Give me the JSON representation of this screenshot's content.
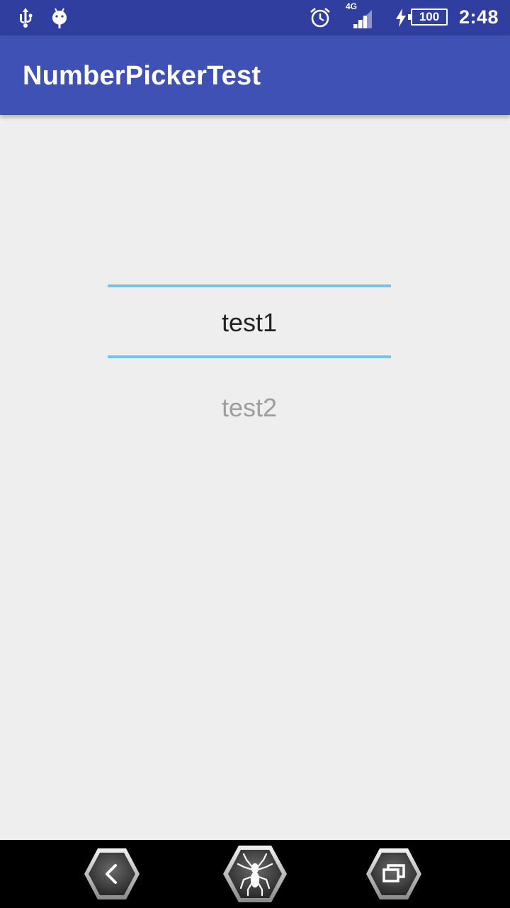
{
  "status_bar": {
    "icons_left": [
      "usb-icon",
      "android-debug-icon"
    ],
    "network_label": "4G",
    "battery_level": "100",
    "time": "2:48",
    "icons_right": [
      "alarm-icon",
      "signal-icon",
      "charging-icon",
      "battery-icon"
    ]
  },
  "app_bar": {
    "title": "NumberPickerTest"
  },
  "picker": {
    "selected_value": "test1",
    "next_value": "test2",
    "accent_color": "#6fc6e6"
  },
  "nav_bar": {
    "buttons": [
      "back-icon",
      "home-spider-icon",
      "recents-icon"
    ]
  },
  "colors": {
    "status_bar": "#303f9f",
    "app_bar": "#3f51b5",
    "background": "#eeeeee"
  }
}
